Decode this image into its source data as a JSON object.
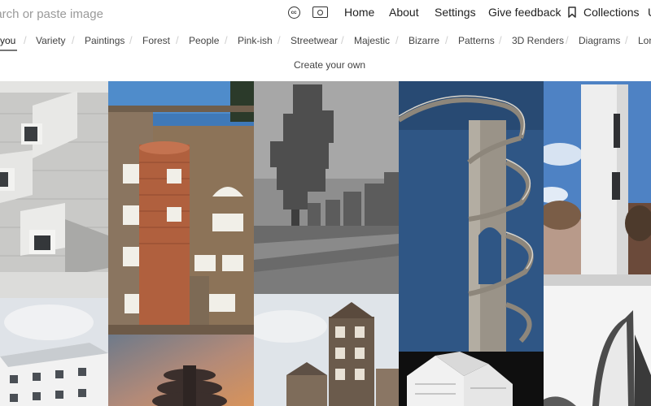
{
  "search": {
    "placeholder": "earch or paste image"
  },
  "icons": {
    "license": "cc-license-icon",
    "image_search": "image-search-icon",
    "collections": "bookmark-icon"
  },
  "license_glyph": "cc",
  "nav": {
    "home": "Home",
    "about": "About",
    "settings": "Settings",
    "feedback": "Give feedback",
    "collections": "Collections",
    "overflow": "U"
  },
  "categories": [
    "you",
    "Variety",
    "Paintings",
    "Forest",
    "People",
    "Pink-ish",
    "Streetwear",
    "Majestic",
    "Bizarre",
    "Patterns",
    "3D Renders",
    "Diagrams",
    "Lon"
  ],
  "active_category": "you",
  "separator": "/",
  "create_own": "Create your own",
  "colors": {
    "text": "#222222",
    "muted": "#9a9a9a",
    "separator": "#cfcfcf",
    "background": "#ffffff"
  }
}
